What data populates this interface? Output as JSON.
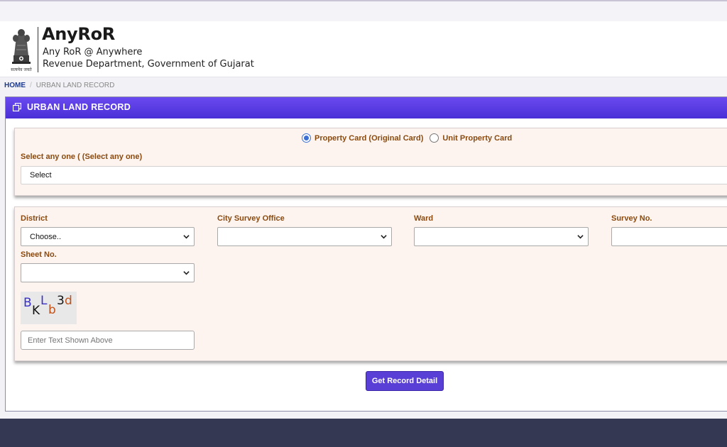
{
  "header": {
    "brand_title": "AnyRoR",
    "brand_sub1": "Any RoR @ Anywhere",
    "brand_sub2": "Revenue Department, Government of Gujarat",
    "emblem_motto": "सत्यमेव जयते"
  },
  "breadcrumb": {
    "home": "HOME",
    "separator": "/",
    "current": "URBAN LAND RECORD"
  },
  "panel": {
    "title": "URBAN LAND RECORD"
  },
  "record_type": {
    "options": [
      {
        "label": "Property Card (Original Card)",
        "selected": true
      },
      {
        "label": "Unit Property Card",
        "selected": false
      }
    ],
    "select_label": "Select any one ( (Select any one)",
    "select_value": "Select"
  },
  "filters": {
    "district_label": "District",
    "district_value": "Choose..",
    "city_survey_label": "City Survey Office",
    "city_survey_value": "",
    "ward_label": "Ward",
    "ward_value": "",
    "survey_no_label": "Survey No.",
    "survey_no_value": "",
    "sheet_no_label": "Sheet No.",
    "sheet_no_value": ""
  },
  "captcha": {
    "chars": [
      "B",
      "K",
      "L",
      "b",
      "3",
      "d"
    ],
    "input_placeholder": "Enter Text Shown Above"
  },
  "actions": {
    "submit_label": "Get Record Detail"
  },
  "colors": {
    "accent": "#5a3fd6",
    "label_brown": "#8a4a0f",
    "form_bg": "#fdf4ef",
    "footer": "#353852"
  }
}
